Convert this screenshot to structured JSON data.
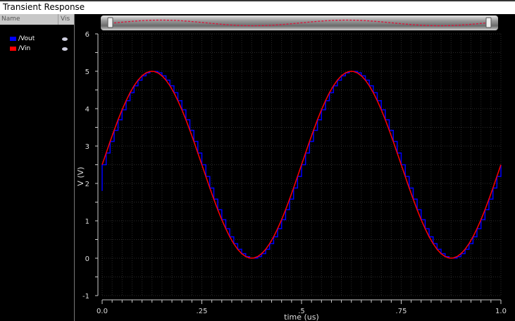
{
  "window": {
    "title": "Transient Response"
  },
  "legend_panel": {
    "header_name": "Name",
    "header_vis": "Vis",
    "signals": [
      {
        "name": "/Vout",
        "color": "#0000ff",
        "visible": true
      },
      {
        "name": "/Vin",
        "color": "#ff0000",
        "visible": true
      }
    ]
  },
  "chart_data": {
    "type": "line",
    "xlabel": "time (us)",
    "ylabel": "V (V)",
    "xlim": [
      0,
      1.0
    ],
    "ylim": [
      -1,
      6
    ],
    "xticks": [
      "0.0",
      ".25",
      ".5",
      ".75",
      "1.0"
    ],
    "xtick_values": [
      0,
      0.25,
      0.5,
      0.75,
      1.0
    ],
    "yticks": [
      "-1",
      "0",
      "1",
      "2",
      "3",
      "4",
      "5",
      "6"
    ],
    "grid": true,
    "background": "#000000",
    "series": [
      {
        "name": "/Vin",
        "color": "#ff0000",
        "style": "line",
        "x_step": 0.01,
        "values": [
          2.5,
          2.813,
          3.122,
          3.42,
          3.704,
          3.969,
          4.211,
          4.426,
          4.611,
          4.762,
          4.878,
          4.956,
          4.995,
          4.995,
          4.956,
          4.878,
          4.762,
          4.611,
          4.426,
          4.211,
          3.969,
          3.704,
          3.42,
          3.122,
          2.813,
          2.5,
          2.187,
          1.878,
          1.58,
          1.296,
          1.031,
          0.789,
          0.574,
          0.389,
          0.238,
          0.122,
          0.044,
          0.005,
          0.005,
          0.044,
          0.122,
          0.238,
          0.389,
          0.574,
          0.789,
          1.031,
          1.296,
          1.58,
          1.878,
          2.187,
          2.5,
          2.813,
          3.122,
          3.42,
          3.704,
          3.969,
          4.211,
          4.426,
          4.611,
          4.762,
          4.878,
          4.956,
          4.995,
          4.995,
          4.956,
          4.878,
          4.762,
          4.611,
          4.426,
          4.211,
          3.969,
          3.704,
          3.42,
          3.122,
          2.813,
          2.5,
          2.187,
          1.878,
          1.58,
          1.296,
          1.031,
          0.789,
          0.574,
          0.389,
          0.238,
          0.122,
          0.044,
          0.005,
          0.005,
          0.044,
          0.122,
          0.238,
          0.389,
          0.574,
          0.789,
          1.031,
          1.296,
          1.58,
          1.878,
          2.187,
          2.5
        ]
      },
      {
        "name": "/Vout",
        "color": "#0000ff",
        "style": "step",
        "x_step": 0.01,
        "initial": 1.8,
        "values": [
          2.5,
          2.813,
          3.122,
          3.42,
          3.704,
          3.969,
          4.211,
          4.426,
          4.611,
          4.762,
          4.878,
          4.956,
          4.995,
          4.995,
          4.956,
          4.878,
          4.762,
          4.611,
          4.426,
          4.211,
          3.969,
          3.704,
          3.42,
          3.122,
          2.813,
          2.5,
          2.187,
          1.878,
          1.58,
          1.296,
          1.031,
          0.789,
          0.574,
          0.389,
          0.238,
          0.122,
          0.044,
          0.005,
          0.005,
          0.044,
          0.122,
          0.238,
          0.389,
          0.574,
          0.789,
          1.031,
          1.296,
          1.58,
          1.878,
          2.187,
          2.5,
          2.813,
          3.122,
          3.42,
          3.704,
          3.969,
          4.211,
          4.426,
          4.611,
          4.762,
          4.878,
          4.956,
          4.995,
          4.995,
          4.956,
          4.878,
          4.762,
          4.611,
          4.426,
          4.211,
          3.969,
          3.704,
          3.42,
          3.122,
          2.813,
          2.5,
          2.187,
          1.878,
          1.58,
          1.296,
          1.031,
          0.789,
          0.574,
          0.389,
          0.238,
          0.122,
          0.044,
          0.005,
          0.005,
          0.044,
          0.122,
          0.238,
          0.389,
          0.574,
          0.789,
          1.031,
          1.296,
          1.58,
          1.878,
          2.187,
          2.5
        ]
      }
    ]
  }
}
